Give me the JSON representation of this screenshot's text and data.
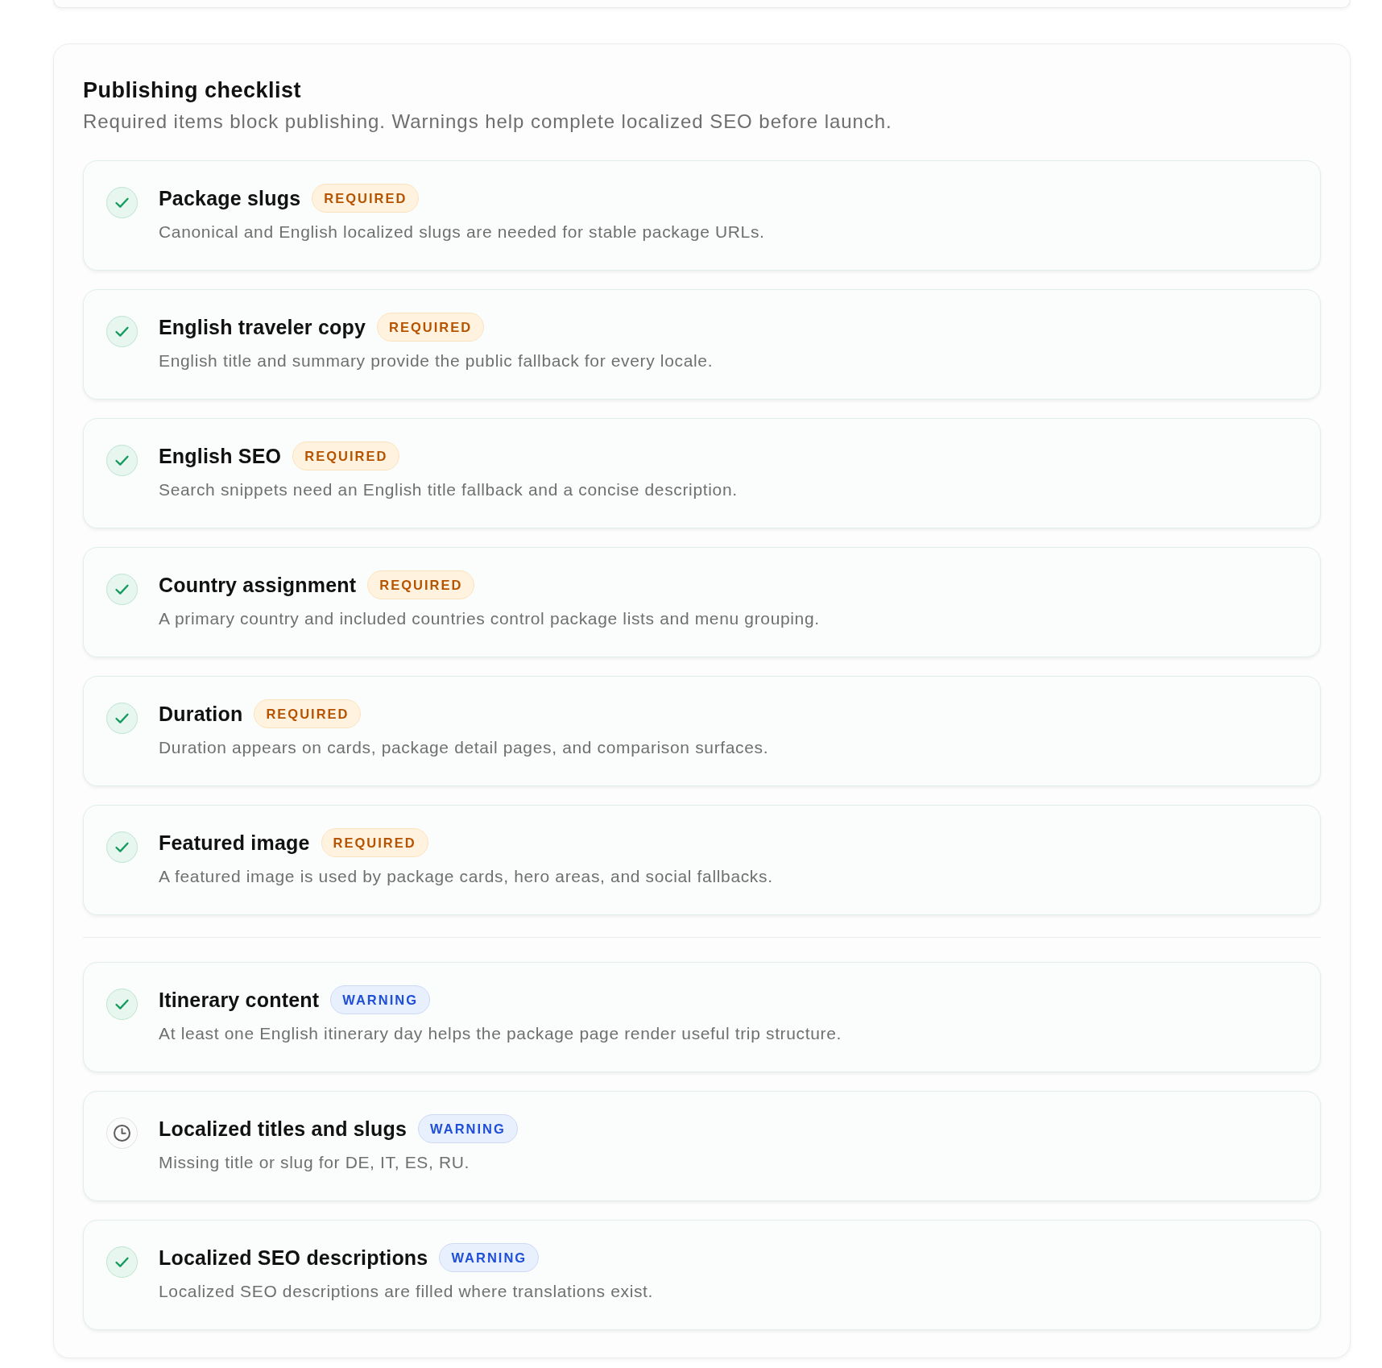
{
  "checklist": {
    "title": "Publishing checklist",
    "subtitle": "Required items block publishing. Warnings help complete localized SEO before launch.",
    "groups": [
      {
        "items": [
          {
            "title": "Package slugs",
            "badge": {
              "kind": "required",
              "label": "REQUIRED"
            },
            "description": "Canonical and English localized slugs are needed for stable package URLs.",
            "complete": true
          },
          {
            "title": "English traveler copy",
            "badge": {
              "kind": "required",
              "label": "REQUIRED"
            },
            "description": "English title and summary provide the public fallback for every locale.",
            "complete": true
          },
          {
            "title": "English SEO",
            "badge": {
              "kind": "required",
              "label": "REQUIRED"
            },
            "description": "Search snippets need an English title fallback and a concise description.",
            "complete": true
          },
          {
            "title": "Country assignment",
            "badge": {
              "kind": "required",
              "label": "REQUIRED"
            },
            "description": "A primary country and included countries control package lists and menu grouping.",
            "complete": true
          },
          {
            "title": "Duration",
            "badge": {
              "kind": "required",
              "label": "REQUIRED"
            },
            "description": "Duration appears on cards, package detail pages, and comparison surfaces.",
            "complete": true
          },
          {
            "title": "Featured image",
            "badge": {
              "kind": "required",
              "label": "REQUIRED"
            },
            "description": "A featured image is used by package cards, hero areas, and social fallbacks.",
            "complete": true
          }
        ]
      },
      {
        "items": [
          {
            "title": "Itinerary content",
            "badge": {
              "kind": "warning",
              "label": "WARNING"
            },
            "description": "At least one English itinerary day helps the package page render useful trip structure.",
            "complete": true
          },
          {
            "title": "Localized titles and slugs",
            "badge": {
              "kind": "warning",
              "label": "WARNING"
            },
            "description": "Missing title or slug for DE, IT, ES, RU.",
            "complete": false
          },
          {
            "title": "Localized SEO descriptions",
            "badge": {
              "kind": "warning",
              "label": "WARNING"
            },
            "description": "Localized SEO descriptions are filled where translations exist.",
            "complete": true
          }
        ]
      }
    ]
  }
}
